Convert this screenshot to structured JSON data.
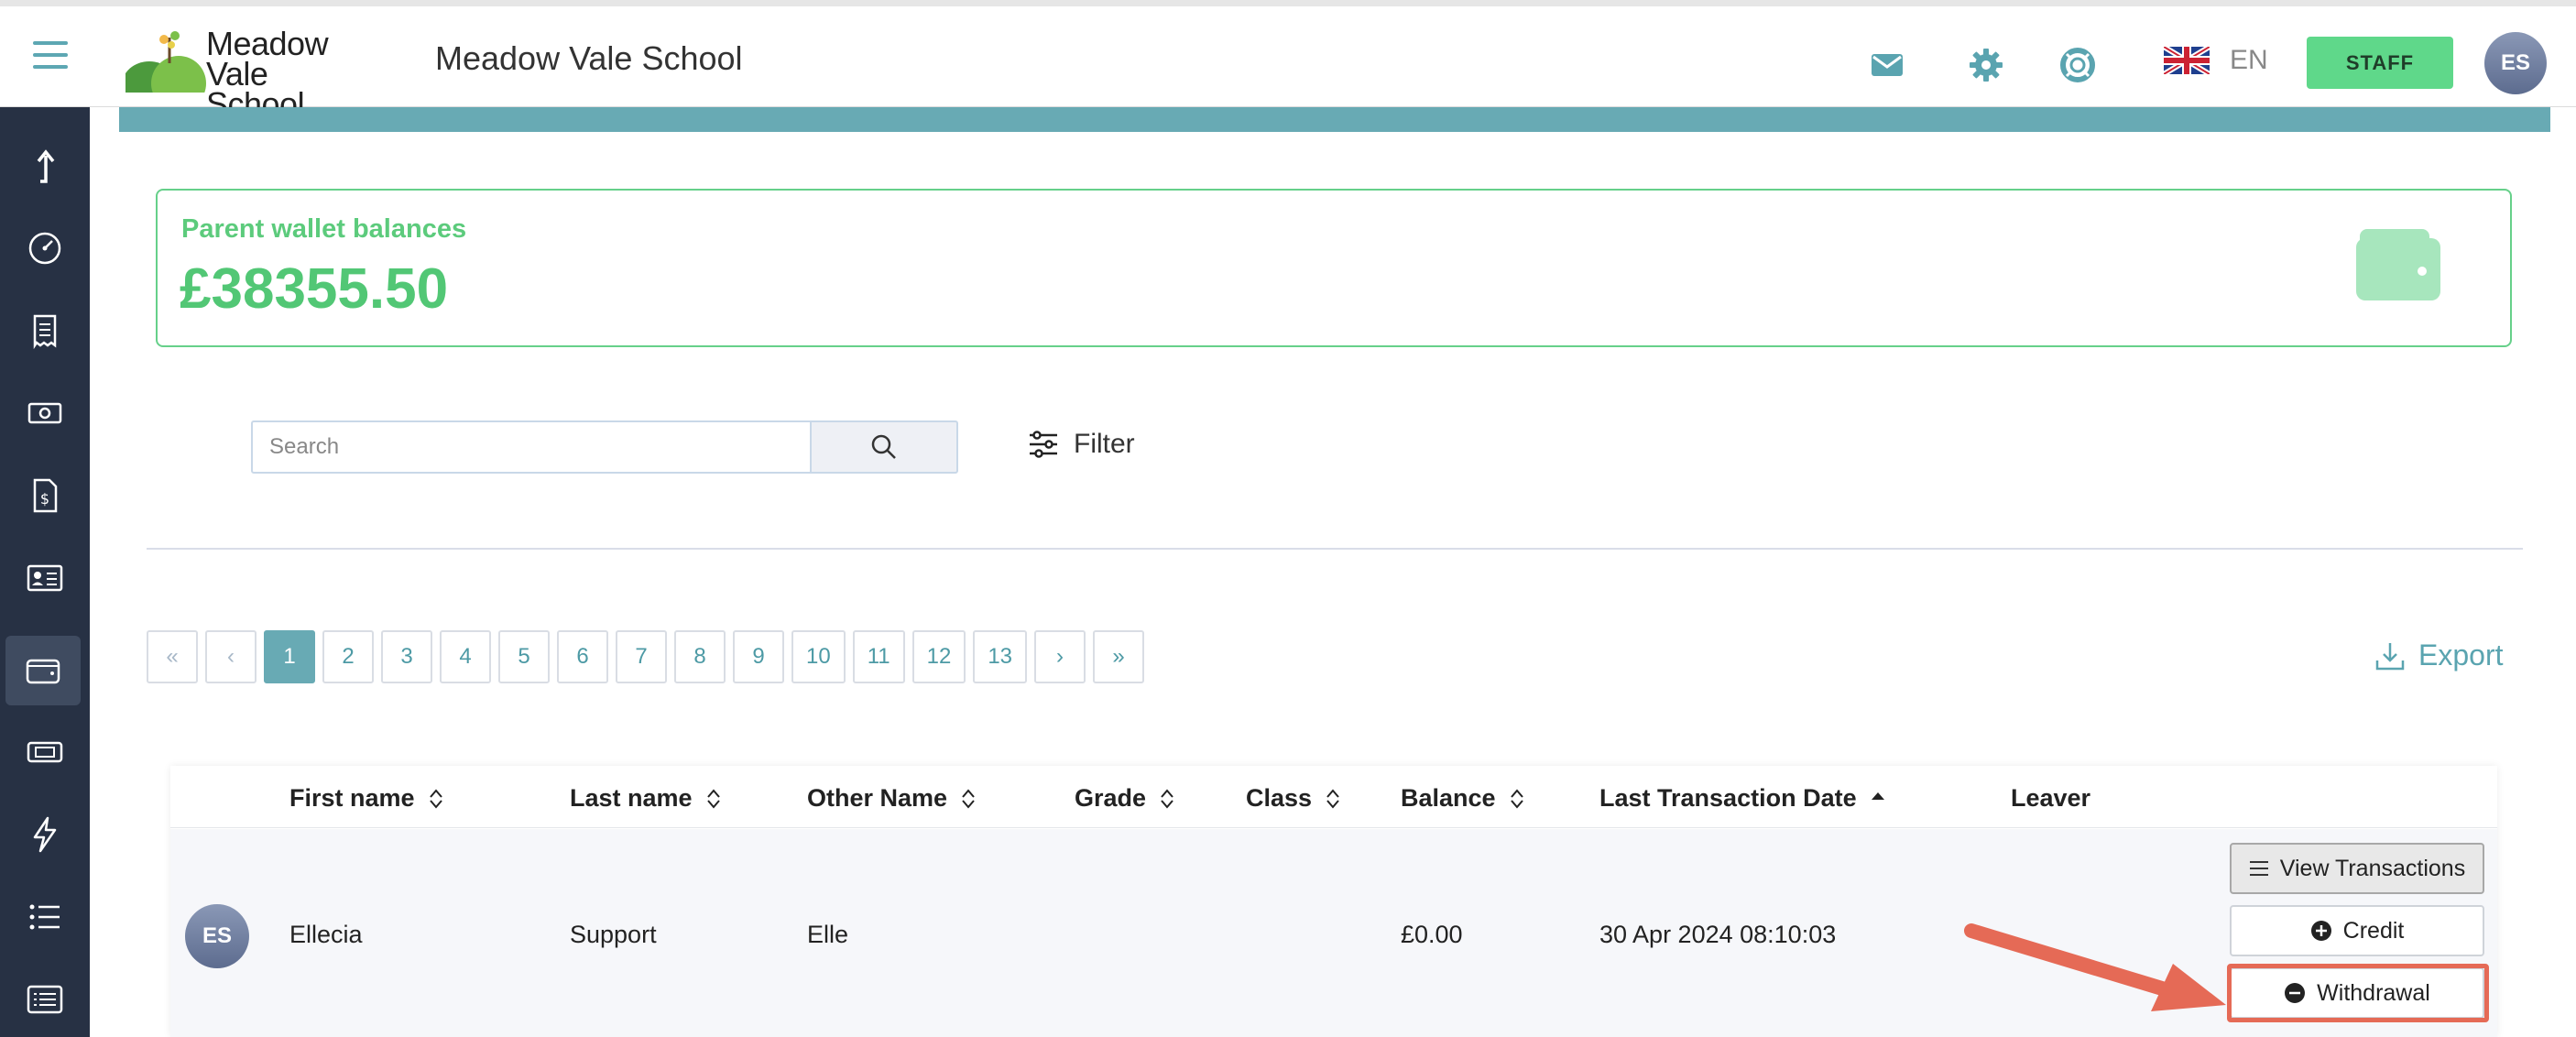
{
  "header": {
    "school_name": "Meadow Vale School",
    "logo_line1": "Meadow",
    "logo_line2": "Vale School",
    "language": "EN",
    "role_button": "STAFF",
    "user_initials": "ES",
    "icons": [
      "mail-icon",
      "gear-icon",
      "lifebuoy-icon",
      "uk-flag-icon"
    ]
  },
  "sidebar": {
    "items": [
      {
        "icon": "upload-arrow-icon"
      },
      {
        "icon": "dashboard-gauge-icon"
      },
      {
        "icon": "receipt-icon"
      },
      {
        "icon": "cash-icon"
      },
      {
        "icon": "invoice-dollar-icon"
      },
      {
        "icon": "id-card-icon"
      },
      {
        "icon": "wallet-icon",
        "active": true
      },
      {
        "icon": "ticket-icon"
      },
      {
        "icon": "lightning-icon"
      },
      {
        "icon": "list-icon"
      },
      {
        "icon": "list-box-icon"
      }
    ]
  },
  "wallet": {
    "label": "Parent wallet balances",
    "balance": "£38355.50"
  },
  "search": {
    "placeholder": "Search",
    "value": ""
  },
  "filter_label": "Filter",
  "pagination": {
    "first": "«",
    "prev": "‹",
    "pages": [
      "1",
      "2",
      "3",
      "4",
      "5",
      "6",
      "7",
      "8",
      "9",
      "10",
      "11",
      "12",
      "13"
    ],
    "current": "1",
    "next": "›",
    "last": "»"
  },
  "export_label": "Export",
  "table": {
    "columns": [
      "First name",
      "Last name",
      "Other Name",
      "Grade",
      "Class",
      "Balance",
      "Last Transaction Date",
      "Leaver"
    ],
    "rows": [
      {
        "initials": "ES",
        "first_name": "Ellecia",
        "last_name": "Support",
        "other_name": "Elle",
        "grade": "",
        "class": "",
        "balance": "£0.00",
        "last_transaction": "30 Apr 2024 08:10:03",
        "leaver": ""
      }
    ],
    "actions": {
      "view": "View Transactions",
      "credit": "Credit",
      "withdrawal": "Withdrawal"
    }
  },
  "colors": {
    "teal": "#68aab4",
    "green": "#5fd88a",
    "sidebar": "#273144",
    "annotation_red": "#e56a56"
  }
}
